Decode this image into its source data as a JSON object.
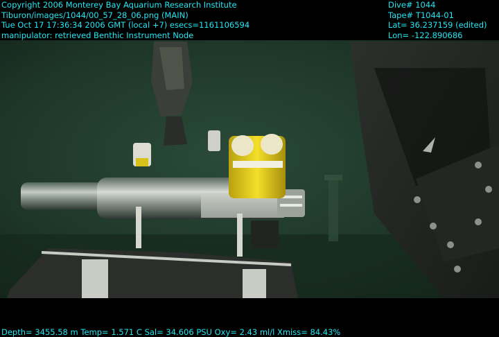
{
  "overlay": {
    "top_left": [
      "Copyright 2006 Monterey Bay Aquarium Research Institute",
      "Tiburon/images/1044/00_57_28_06.png (MAIN)",
      "Tue Oct 17 17:36:34 2006 GMT (local +7)  esecs=1161106594",
      "manipulator: retrieved Benthic Instrument Node"
    ],
    "top_right": [
      "Dive# 1044",
      "Tape# T1044-01",
      "Lat= 36.237159 (edited)",
      "Lon= -122.890686"
    ],
    "bottom": "Depth= 3455.58 m  Temp= 1.571 C  Sal= 34.606 PSU  Oxy= 2.43 ml/l  Xmiss= 84.43%"
  },
  "colors": {
    "overlay_text": "#22e6f2",
    "water": "#1f3a2c",
    "seafloor": "#16281c",
    "instrument_yellow": "#e9d21d"
  }
}
